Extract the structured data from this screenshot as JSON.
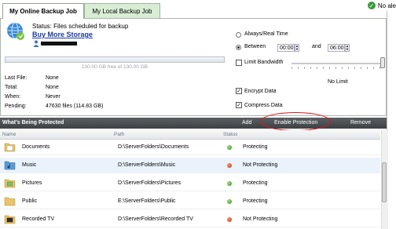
{
  "tabs": [
    {
      "label": "My Online Backup Job",
      "active": true
    },
    {
      "label": "My Local Backup Job",
      "active": false
    }
  ],
  "alerts": {
    "label": "No ale",
    "icon": "check-circle-icon"
  },
  "status": {
    "text": "Status: Files scheduled for backup",
    "buy_link": "Buy More Storage",
    "storage_text": "130.00 GB free of 130.00 GB",
    "free_fraction": 1.0
  },
  "info": [
    {
      "label": "Last File:",
      "value": "None"
    },
    {
      "label": "Total:",
      "value": "None"
    },
    {
      "label": "When:",
      "value": "Never"
    },
    {
      "label": "Pending:",
      "value": "47630 files (114.83 GB)"
    }
  ],
  "schedule": {
    "always_label": "Always/Real Time",
    "between_label": "Between",
    "between_selected": true,
    "from_time": "00:00",
    "and_label": "and",
    "to_time": "06:00"
  },
  "bandwidth": {
    "limit_label": "Limit Bandwidth",
    "limit_checked": false,
    "value_label": "No Limit"
  },
  "encrypt": {
    "label": "Encrypt Data",
    "checked": true
  },
  "compress": {
    "label": "Compress Data",
    "checked": true
  },
  "protected": {
    "title": "What's Being Protected",
    "add": "Add",
    "enable": "Enable Protection",
    "remove": "Remove"
  },
  "table": {
    "headers": [
      "Name",
      "Path",
      "Status"
    ],
    "rows": [
      {
        "name": "Documents",
        "path": "D:\\ServerFolders\\Documents",
        "status": "Protecting",
        "state": "green",
        "icon": "folder-documents-icon"
      },
      {
        "name": "Music",
        "path": "D:\\ServerFolders\\Music",
        "status": "Not Protecting",
        "state": "red",
        "icon": "folder-music-icon"
      },
      {
        "name": "Pictures",
        "path": "D:\\ServerFolders\\Pictures",
        "status": "Protecting",
        "state": "green",
        "icon": "folder-pictures-icon"
      },
      {
        "name": "Public",
        "path": "E:\\ServerFolders\\Public",
        "status": "Protecting",
        "state": "green",
        "icon": "folder-public-icon"
      },
      {
        "name": "Recorded TV",
        "path": "D:\\ServerFolders\\Recorded TV",
        "status": "Not Protecting",
        "state": "red",
        "icon": "folder-tv-icon"
      }
    ]
  },
  "colors": {
    "accent_link": "#1a3aa0",
    "highlight_oval": "#e0151c",
    "band": "#4a4e52"
  }
}
